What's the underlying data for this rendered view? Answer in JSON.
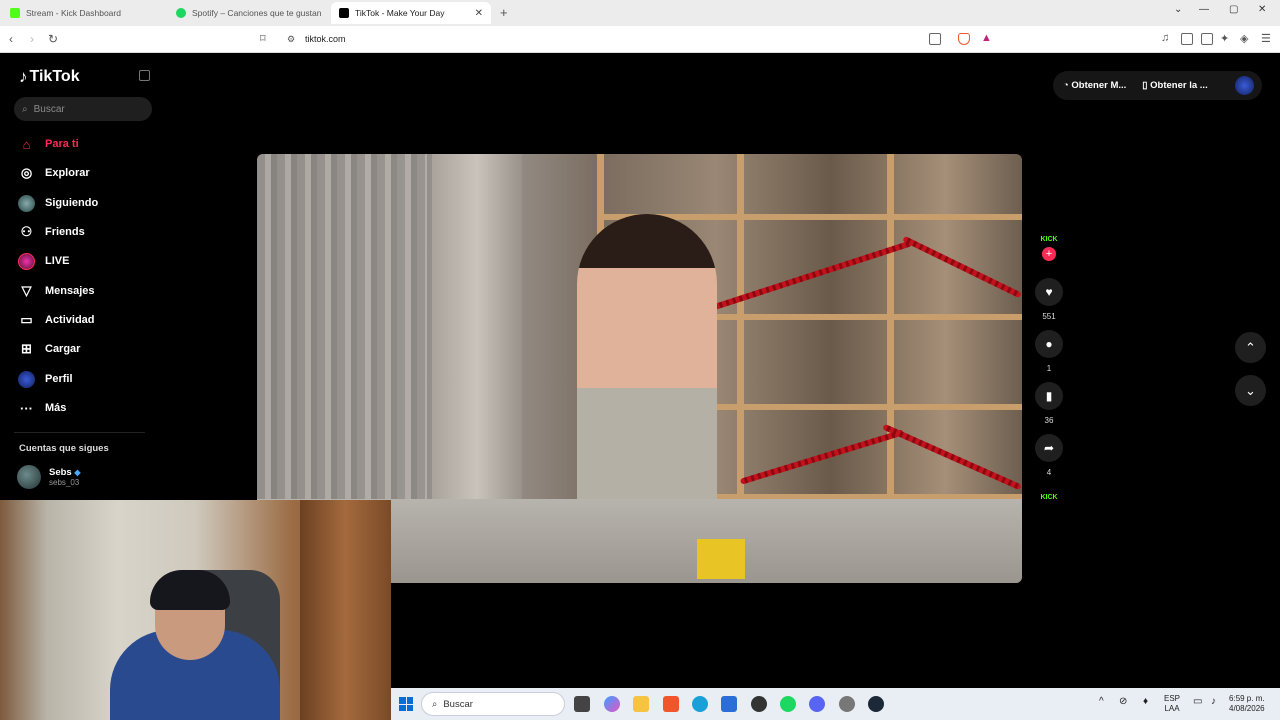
{
  "browser": {
    "tabs": [
      {
        "title": "Stream - Kick Dashboard",
        "color": "#53fc18"
      },
      {
        "title": "Spotify – Canciones que te gustan",
        "color": "#1ed760"
      },
      {
        "title": "TikTok - Make Your Day",
        "color": "#000000"
      }
    ],
    "url": "tiktok.com"
  },
  "tiktok": {
    "brand": "TikTok",
    "search_placeholder": "Buscar",
    "nav": [
      {
        "label": "Para ti",
        "icon": "home-icon"
      },
      {
        "label": "Explorar",
        "icon": "compass-icon"
      },
      {
        "label": "Siguiendo",
        "icon": "following-avatar-icon"
      },
      {
        "label": "Friends",
        "icon": "friends-icon"
      },
      {
        "label": "LIVE",
        "icon": "live-avatar-icon"
      },
      {
        "label": "Mensajes",
        "icon": "send-icon"
      },
      {
        "label": "Actividad",
        "icon": "inbox-icon"
      },
      {
        "label": "Cargar",
        "icon": "upload-plus-icon"
      },
      {
        "label": "Perfil",
        "icon": "profile-avatar-icon"
      },
      {
        "label": "Más",
        "icon": "more-dots-icon"
      }
    ],
    "following_section": "Cuentas que sigues",
    "following": [
      {
        "name": "Sebs",
        "handle": "sebs_03"
      }
    ],
    "top_buttons": [
      "Obtener M...",
      "Obtener la ..."
    ],
    "actions": {
      "kick_label": "KICK",
      "likes": "551",
      "comments": "1",
      "saves": "36",
      "shares": "4"
    },
    "accent": "#fe2c55"
  },
  "taskbar": {
    "search_placeholder": "Buscar",
    "lang": "ESP",
    "lang_sub": "LAA",
    "time": "6:59 p. m.",
    "date": "4/08/2026"
  }
}
